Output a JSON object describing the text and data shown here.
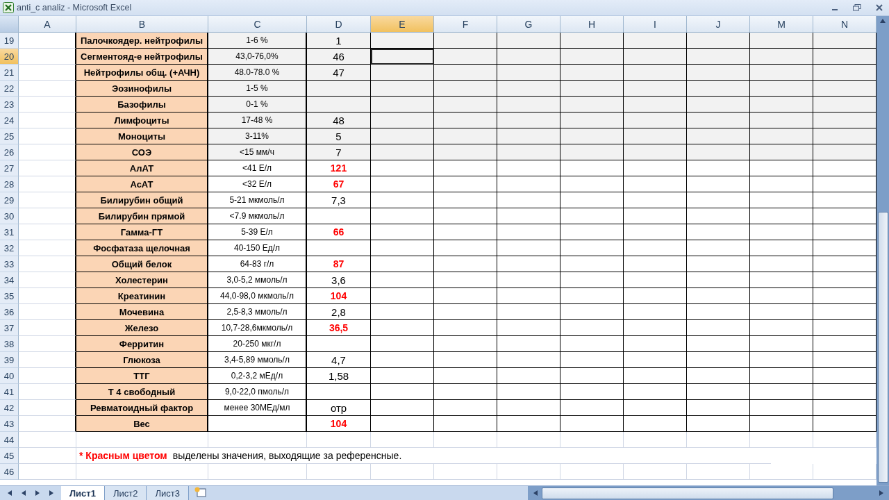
{
  "window": {
    "title": "anti_c analiz - Microsoft Excel"
  },
  "columns": [
    {
      "label": "A",
      "selected": false
    },
    {
      "label": "B",
      "selected": false
    },
    {
      "label": "C",
      "selected": false
    },
    {
      "label": "D",
      "selected": false
    },
    {
      "label": "E",
      "selected": true
    },
    {
      "label": "F",
      "selected": false
    },
    {
      "label": "G",
      "selected": false
    },
    {
      "label": "H",
      "selected": false
    },
    {
      "label": "I",
      "selected": false
    },
    {
      "label": "J",
      "selected": false
    },
    {
      "label": "M",
      "selected": false
    },
    {
      "label": "N",
      "selected": false
    }
  ],
  "rows": [
    {
      "num": "19",
      "selected": false,
      "shaded": true,
      "name": "Палочкоядер. нейтрофилы",
      "range": "1-6 %",
      "value": "1",
      "flagged": false
    },
    {
      "num": "20",
      "selected": true,
      "shaded": true,
      "name": "Сегментояд-е нейтрофилы",
      "range": "43,0-76,0%",
      "value": "46",
      "flagged": false
    },
    {
      "num": "21",
      "selected": false,
      "shaded": true,
      "name": "Нейтрофилы общ. (+АЧН)",
      "range": "48.0-78.0 %",
      "value": "47",
      "flagged": false
    },
    {
      "num": "22",
      "selected": false,
      "shaded": true,
      "name": "Эозинофилы",
      "range": "1-5 %",
      "flagged": false
    },
    {
      "num": "23",
      "selected": false,
      "shaded": true,
      "name": "Базофилы",
      "range": "0-1 %",
      "flagged": false
    },
    {
      "num": "24",
      "selected": false,
      "shaded": true,
      "name": "Лимфоциты",
      "range": "17-48 %",
      "value": "48",
      "flagged": false
    },
    {
      "num": "25",
      "selected": false,
      "shaded": true,
      "name": "Моноциты",
      "range": "3-11%",
      "value": "5",
      "flagged": false
    },
    {
      "num": "26",
      "selected": false,
      "shaded": true,
      "name": "СОЭ",
      "range": "<15 мм/ч",
      "value": "7",
      "flagged": false
    },
    {
      "num": "27",
      "selected": false,
      "shaded": false,
      "name": "АлАТ",
      "range": "<41 Е/л",
      "value": "121",
      "flagged": true
    },
    {
      "num": "28",
      "selected": false,
      "shaded": false,
      "name": "АсАТ",
      "range": "<32 Е/л",
      "value": "67",
      "flagged": true
    },
    {
      "num": "29",
      "selected": false,
      "shaded": false,
      "name": "Билирубин общий",
      "range": "5-21 мкмоль/л",
      "value": "7,3",
      "flagged": false
    },
    {
      "num": "30",
      "selected": false,
      "shaded": false,
      "name": "Билирубин прямой",
      "range": "<7.9 мкмоль/л",
      "flagged": false
    },
    {
      "num": "31",
      "selected": false,
      "shaded": false,
      "name": "Гамма-ГТ",
      "range": "5-39 Е/л",
      "value": "66",
      "flagged": true
    },
    {
      "num": "32",
      "selected": false,
      "shaded": false,
      "name": "Фосфатаза щелочная",
      "range": "40-150 Ед/л",
      "flagged": false
    },
    {
      "num": "33",
      "selected": false,
      "shaded": false,
      "name": "Общий белок",
      "range": "64-83 г/л",
      "value": "87",
      "flagged": true
    },
    {
      "num": "34",
      "selected": false,
      "shaded": false,
      "name": "Холестерин",
      "range": "3,0-5,2 ммоль/л",
      "value": "3,6",
      "flagged": false
    },
    {
      "num": "35",
      "selected": false,
      "shaded": false,
      "name": "Креатинин",
      "range": "44,0-98,0 мкмоль/л",
      "value": "104",
      "flagged": true
    },
    {
      "num": "36",
      "selected": false,
      "shaded": false,
      "name": "Мочевина",
      "range": "2,5-8,3 ммоль/л",
      "value": "2,8",
      "flagged": false
    },
    {
      "num": "37",
      "selected": false,
      "shaded": false,
      "name": "Железо",
      "range": "10,7-28,6мкмоль/л",
      "value": "36,5",
      "flagged": true
    },
    {
      "num": "38",
      "selected": false,
      "shaded": false,
      "name": "Ферритин",
      "range": "20-250 мкг/л",
      "flagged": false
    },
    {
      "num": "39",
      "selected": false,
      "shaded": false,
      "name": "Глюкоза",
      "range": "3,4-5,89 ммоль/л",
      "value": "4,7",
      "flagged": false
    },
    {
      "num": "40",
      "selected": false,
      "shaded": false,
      "name": "ТТГ",
      "range": "0,2-3,2 мЕд/л",
      "value": "1,58",
      "flagged": false
    },
    {
      "num": "41",
      "selected": false,
      "shaded": false,
      "name": "Т 4 свободный",
      "range": "9,0-22,0 пмоль/л",
      "flagged": false
    },
    {
      "num": "42",
      "selected": false,
      "shaded": false,
      "name": "Ревматоидный фактор",
      "range": "менее 30МЕд/мл",
      "value": "отр",
      "flagged": false
    },
    {
      "num": "43",
      "selected": false,
      "shaded": false,
      "name": "Вес",
      "value": "104",
      "flagged": true
    }
  ],
  "extra_rows": [
    {
      "num": "44"
    },
    {
      "num": "45",
      "note": {
        "highlight": "* Красным цветом",
        "text": "выделены значения, выходящие за референсные."
      }
    },
    {
      "num": "46"
    }
  ],
  "sheets": [
    {
      "label": "Лист1",
      "selected": true
    },
    {
      "label": "Лист2",
      "selected": false
    },
    {
      "label": "Лист3",
      "selected": false
    }
  ]
}
